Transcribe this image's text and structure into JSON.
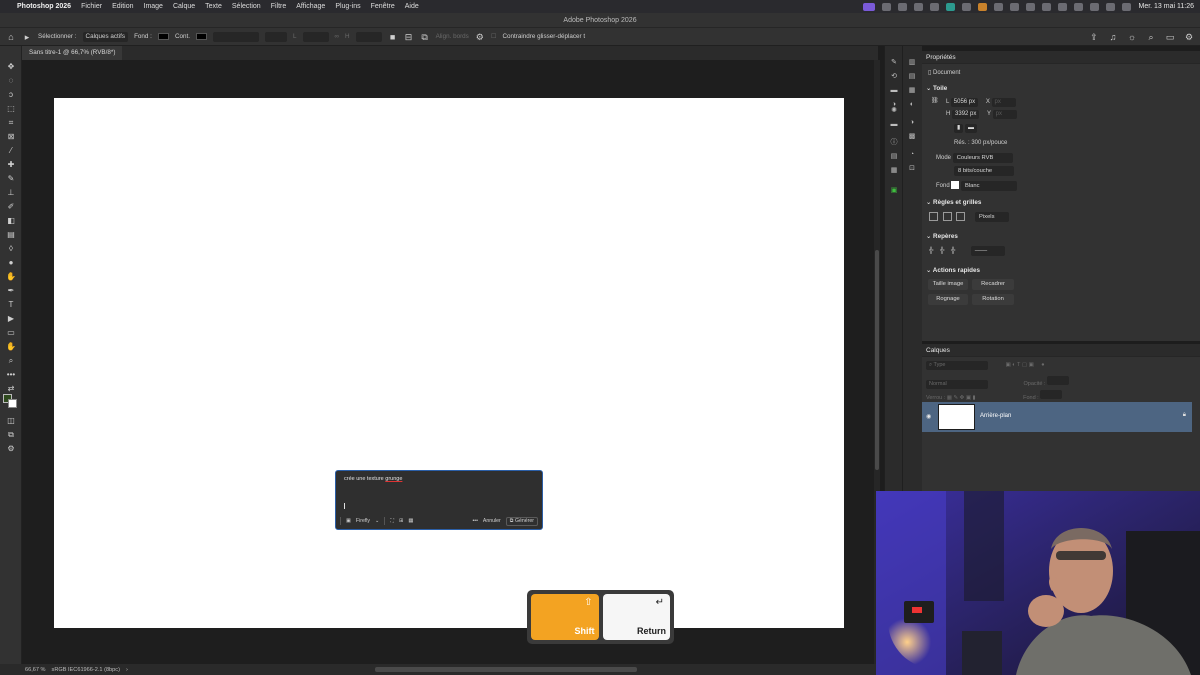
{
  "menubar": {
    "app_name": "Photoshop 2026",
    "items": [
      "Fichier",
      "Edition",
      "Image",
      "Calque",
      "Texte",
      "Sélection",
      "Filtre",
      "Affichage",
      "Plug-ins",
      "Fenêtre",
      "Aide"
    ],
    "clock": "Mer. 13 mai  11:26"
  },
  "window": {
    "title": "Adobe Photoshop 2026"
  },
  "options_bar": {
    "select_label": "Sélectionner :",
    "select_value": "Calques actifs",
    "fill_label": "Fond :",
    "stroke_label": "Cont.",
    "align_label": "Align. bords",
    "constrain_label": "Contraindre glisser-déplacer t"
  },
  "document": {
    "tab_label": "Sans titre-1 @ 66,7% (RVB/8*)",
    "canvas_color": "#ffffff"
  },
  "generative_fill": {
    "prompt_prefix": "crée une texture ",
    "prompt_highlight": "grunge",
    "model": "Firefly",
    "more": "•••",
    "cancel": "Annuler",
    "generate": "Générer",
    "accent": "#2b5fa8"
  },
  "key_overlay": {
    "shift_label": "Shift",
    "shift_symbol": "⇧",
    "return_label": "Return",
    "return_symbol": "↵",
    "shift_color": "#f3a322"
  },
  "statusbar": {
    "zoom": "66,67 %",
    "profile": "sRGB IEC61966-2.1 (8bpc)",
    "arrow": "›"
  },
  "properties": {
    "title": "Propriétés",
    "doc_label": "Document",
    "canvas_section": "Toile",
    "width_label": "L",
    "width_value": "5056 px",
    "height_label": "H",
    "height_value": "3392 px",
    "x_label": "X",
    "y_label": "Y",
    "x_unit": "px",
    "y_unit": "px",
    "resolution": "Rés. : 300 px/pouce",
    "mode_label": "Mode",
    "mode_value": "Couleurs RVB",
    "bits_value": "8 bits/couche",
    "bg_label": "Fond",
    "bg_value": "Blanc",
    "rulers_section": "Règles et grilles",
    "units_value": "Pixels",
    "guides_section": "Repères",
    "quick_section": "Actions rapides",
    "btn_image_size": "Taille image",
    "btn_crop": "Recadrer",
    "btn_trim": "Rognage",
    "btn_rotate": "Rotation"
  },
  "layers": {
    "title": "Calques",
    "search_placeholder": "Type",
    "blend_mode": "Normal",
    "opacity_label": "Opacité :",
    "lock_label": "Verrou :",
    "fill_label": "Fond :",
    "layer_name": "Arrière-plan",
    "selected_color": "#4d6582"
  }
}
